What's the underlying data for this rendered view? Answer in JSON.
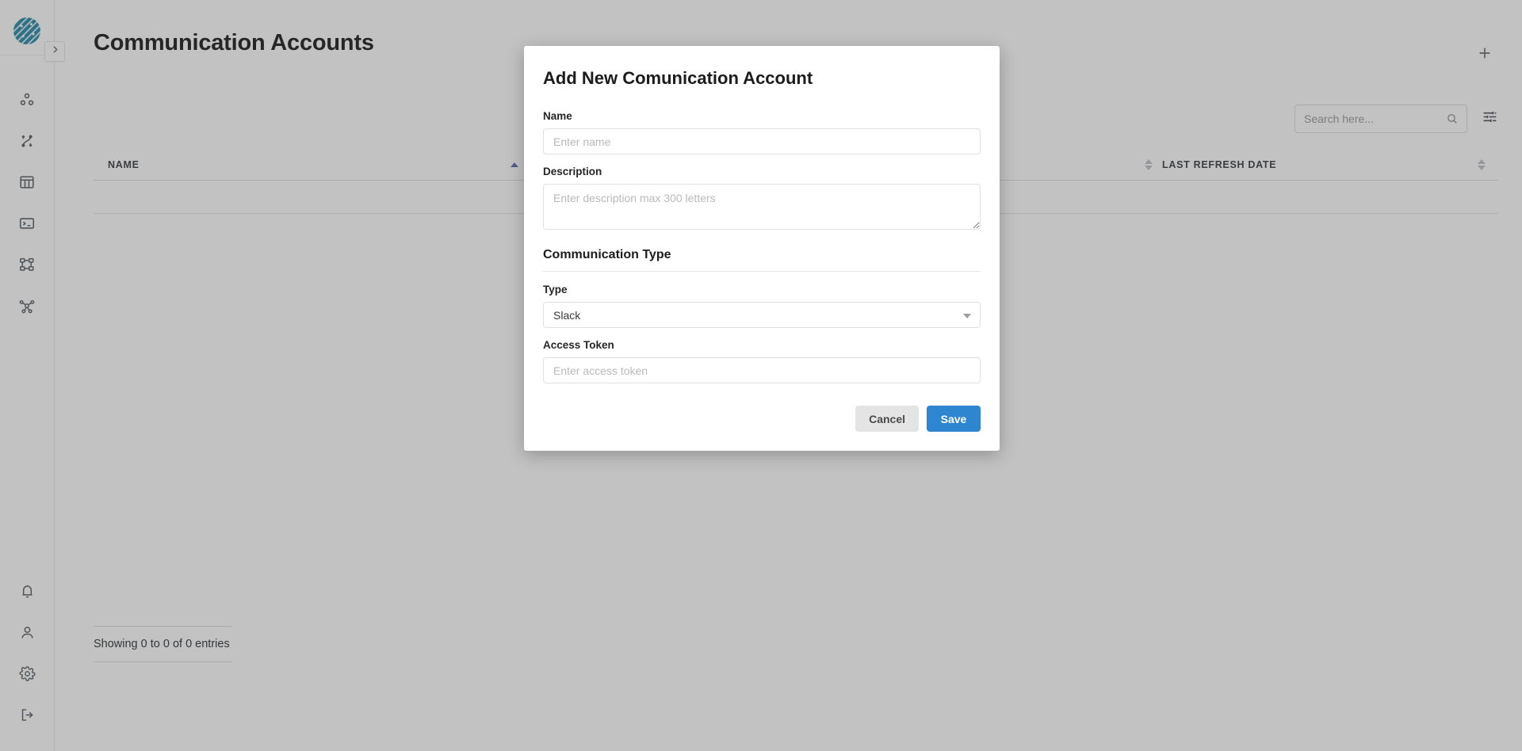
{
  "app": {
    "logo_name": "app-logo"
  },
  "sidebar": {
    "expand_icon": "chevron-right-icon",
    "items": [
      {
        "name": "sidebar-item-clusters",
        "icon": "dots-circles-icon",
        "label": "Clusters"
      },
      {
        "name": "sidebar-item-pipelines",
        "icon": "pipeline-flow-icon",
        "label": "Pipelines"
      },
      {
        "name": "sidebar-item-tables",
        "icon": "table-grid-icon",
        "label": "Tables"
      },
      {
        "name": "sidebar-item-console",
        "icon": "terminal-icon",
        "label": "Console"
      },
      {
        "name": "sidebar-item-hierarchy",
        "icon": "sitemap-icon",
        "label": "Hierarchy"
      },
      {
        "name": "sidebar-item-network",
        "icon": "network-hub-icon",
        "label": "Network"
      }
    ],
    "bottom_items": [
      {
        "name": "sidebar-item-notifications",
        "icon": "bell-icon",
        "label": "Notifications"
      },
      {
        "name": "sidebar-item-profile",
        "icon": "user-icon",
        "label": "Profile"
      },
      {
        "name": "sidebar-item-settings",
        "icon": "gear-icon",
        "label": "Settings"
      },
      {
        "name": "sidebar-item-logout",
        "icon": "logout-icon",
        "label": "Logout"
      }
    ]
  },
  "header": {
    "title": "Communication Accounts",
    "add_button_icon": "plus-icon"
  },
  "toolbar": {
    "search_placeholder": "Search here...",
    "search_value": "",
    "search_icon": "search-icon",
    "filter_icon": "filter-sliders-icon"
  },
  "table": {
    "columns": [
      {
        "label": "NAME",
        "sorted": "asc"
      },
      {
        "label": "",
        "sorted": "none"
      },
      {
        "label": "",
        "sorted": "none"
      },
      {
        "label": "LAST REFRESH DATE",
        "sorted": "none"
      }
    ],
    "rows": [],
    "entries_info": "Showing 0 to 0 of 0 entries"
  },
  "modal": {
    "title": "Add New Comunication Account",
    "name_label": "Name",
    "name_placeholder": "Enter name",
    "name_value": "",
    "description_label": "Description",
    "description_placeholder": "Enter description max 300 letters",
    "description_value": "",
    "section_title": "Communication Type",
    "type_label": "Type",
    "type_value": "Slack",
    "type_options": [
      "Slack"
    ],
    "access_token_label": "Access Token",
    "access_token_placeholder": "Enter access token",
    "access_token_value": "",
    "cancel_label": "Cancel",
    "save_label": "Save"
  },
  "colors": {
    "accent_blue": "#2e86d0",
    "logo_teal": "#2b8aa8",
    "sort_active": "#5d6bb3",
    "overlay": "rgba(58,58,58,0.31)"
  }
}
